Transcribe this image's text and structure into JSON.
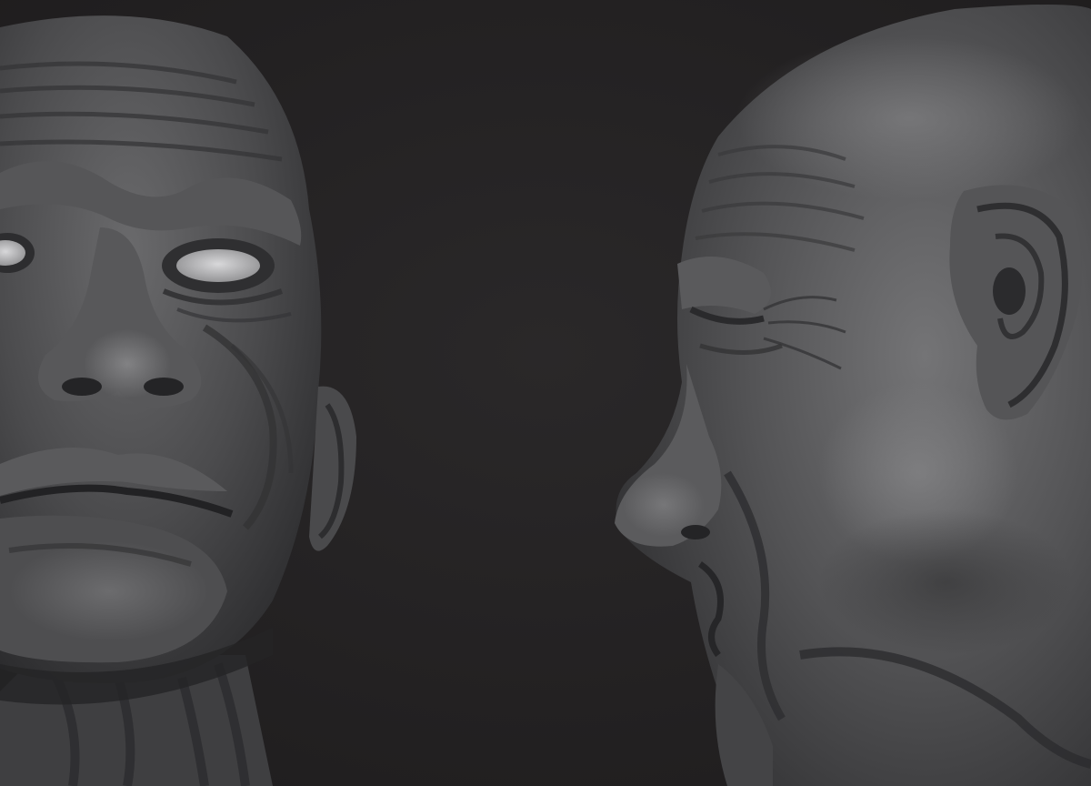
{
  "scene": {
    "subject_left": "old-man-head-sculpt-front-view",
    "subject_right": "old-man-head-sculpt-side-view",
    "material": "clay-matcap",
    "colors": {
      "background": "#252324",
      "clay_light": "#6e6e70",
      "clay_mid": "#4a4a4c",
      "clay_dark": "#2a2a2c",
      "eye_white": "#c9c9cb"
    }
  }
}
